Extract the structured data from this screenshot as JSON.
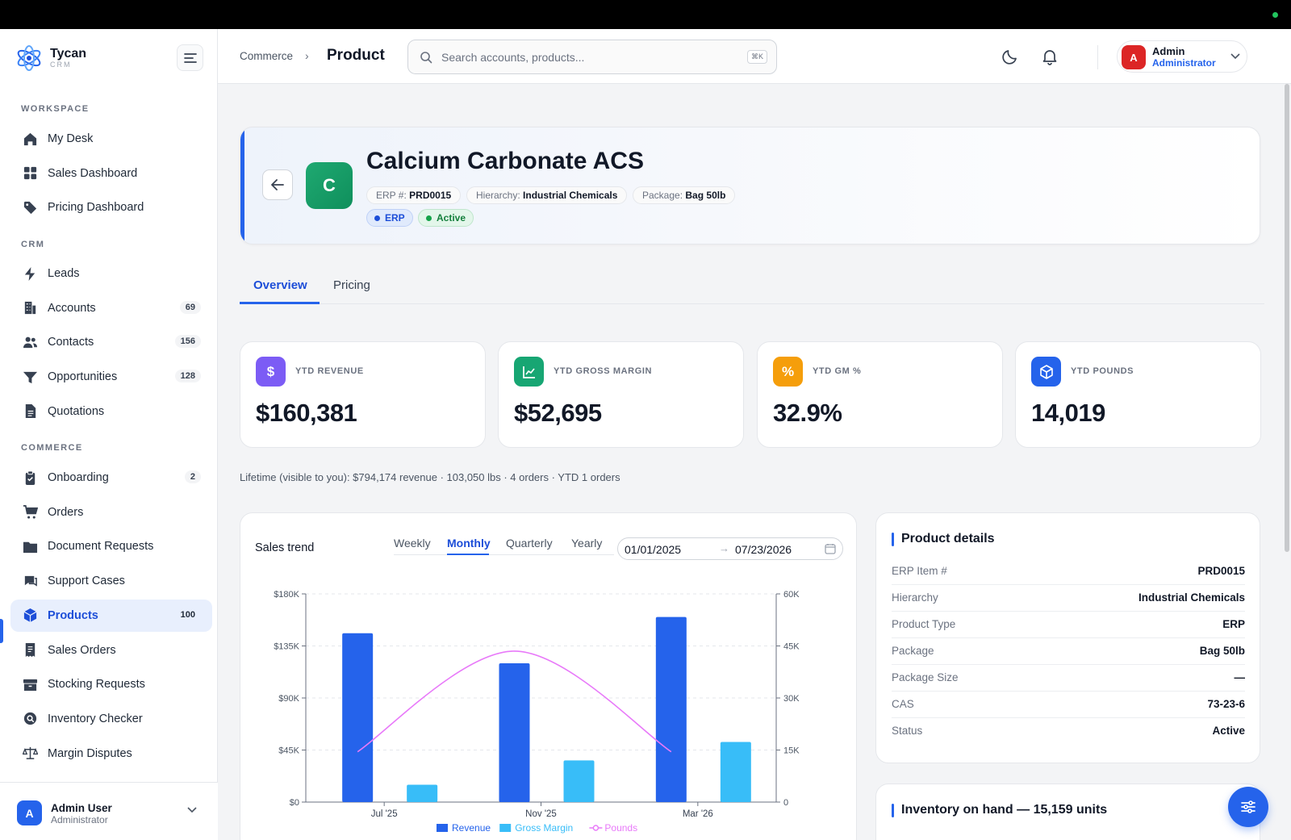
{
  "brand": {
    "name": "Tycan",
    "sub": "CRM"
  },
  "sidebar": {
    "sections": {
      "workspace": "WORKSPACE",
      "crm": "CRM",
      "commerce": "COMMERCE"
    },
    "workspace": [
      {
        "label": "My Desk",
        "icon": "home-icon"
      },
      {
        "label": "Sales Dashboard",
        "icon": "grid-icon"
      },
      {
        "label": "Pricing Dashboard",
        "icon": "tag-icon"
      }
    ],
    "crm": [
      {
        "label": "Leads",
        "icon": "bolt-icon"
      },
      {
        "label": "Accounts",
        "icon": "building-icon",
        "badge": "69"
      },
      {
        "label": "Contacts",
        "icon": "users-icon",
        "badge": "156"
      },
      {
        "label": "Opportunities",
        "icon": "funnel-icon",
        "badge": "128"
      },
      {
        "label": "Quotations",
        "icon": "document-icon"
      }
    ],
    "commerce": [
      {
        "label": "Onboarding",
        "icon": "clipboard-check-icon",
        "badge": "2"
      },
      {
        "label": "Orders",
        "icon": "cart-icon"
      },
      {
        "label": "Document Requests",
        "icon": "folder-icon"
      },
      {
        "label": "Support Cases",
        "icon": "chat-icon"
      },
      {
        "label": "Products",
        "icon": "cube-icon",
        "badge": "100",
        "active": true
      },
      {
        "label": "Sales Orders",
        "icon": "receipt-icon"
      },
      {
        "label": "Stocking Requests",
        "icon": "archive-icon"
      },
      {
        "label": "Inventory Checker",
        "icon": "magnifier-icon"
      },
      {
        "label": "Margin Disputes",
        "icon": "scale-icon"
      }
    ],
    "user": {
      "initial": "A",
      "name": "Admin User",
      "role": "Administrator"
    }
  },
  "header": {
    "breadcrumb_parent": "Commerce",
    "breadcrumb_sep": "›",
    "page_title": "Product",
    "search_placeholder": "Search accounts, products...",
    "search_shortcut": "⌘K",
    "profile": {
      "initial": "A",
      "name": "Admin",
      "role": "Administrator"
    }
  },
  "product": {
    "initial": "C",
    "name": "Calcium Carbonate ACS",
    "chips": [
      {
        "key": "ERP #:",
        "value": "PRD0015"
      },
      {
        "key": "Hierarchy:",
        "value": "Industrial Chemicals"
      },
      {
        "key": "Package:",
        "value": "Bag 50lb"
      }
    ],
    "tags": [
      "ERP",
      "Active"
    ]
  },
  "tabs": [
    "Overview",
    "Pricing"
  ],
  "kpis": [
    {
      "label": "YTD REVENUE",
      "value": "$160,381",
      "icon": "dollar-icon",
      "color": "#7c5cf5",
      "glyph": "$"
    },
    {
      "label": "YTD GROSS MARGIN",
      "value": "$52,695",
      "icon": "line-chart-icon",
      "color": "#17a673",
      "glyph": ""
    },
    {
      "label": "YTD GM %",
      "value": "32.9%",
      "icon": "percent-icon",
      "color": "#f59e0b",
      "glyph": "%"
    },
    {
      "label": "YTD POUNDS",
      "value": "14,019",
      "icon": "box-icon",
      "color": "#2563eb",
      "glyph": ""
    }
  ],
  "lifetime": "Lifetime (visible to you): $794,174 revenue · 103,050 lbs · 4 orders · YTD 1 orders",
  "sales_trend": {
    "title": "Sales trend",
    "ranges": [
      "Weekly",
      "Monthly",
      "Quarterly",
      "Yearly"
    ],
    "active_range": "Monthly",
    "date_from": "01/01/2025",
    "date_arrow": "→",
    "date_to": "07/23/2026"
  },
  "chart_data": {
    "type": "bar",
    "categories": [
      "Jul '25",
      "Nov '25",
      "Mar '26"
    ],
    "series": [
      {
        "name": "Revenue",
        "type": "bar",
        "axis": "left",
        "color": "#2563eb",
        "values": [
          146000,
          120000,
          160000
        ]
      },
      {
        "name": "Gross Margin",
        "type": "bar",
        "axis": "left",
        "color": "#38bdf8",
        "values": [
          15000,
          36000,
          52000
        ]
      },
      {
        "name": "Pounds",
        "type": "line",
        "axis": "right",
        "color": "#e879f9",
        "values": [
          14500,
          43500,
          14500
        ]
      }
    ],
    "y_left": {
      "ticks": [
        "$0",
        "$45K",
        "$90K",
        "$135K",
        "$180K"
      ],
      "min": 0,
      "max": 180000
    },
    "y_right": {
      "ticks": [
        "0",
        "15K",
        "30K",
        "45K",
        "60K"
      ],
      "min": 0,
      "max": 60000
    },
    "grid": true,
    "legend": "bottom"
  },
  "product_details": {
    "title": "Product details",
    "rows": [
      {
        "key": "ERP Item #",
        "value": "PRD0015"
      },
      {
        "key": "Hierarchy",
        "value": "Industrial Chemicals"
      },
      {
        "key": "Product Type",
        "value": "ERP"
      },
      {
        "key": "Package",
        "value": "Bag 50lb"
      },
      {
        "key": "Package Size",
        "value": "—"
      },
      {
        "key": "CAS",
        "value": "73-23-6"
      },
      {
        "key": "Status",
        "value": "Active"
      }
    ]
  },
  "inventory": {
    "title": "Inventory on hand — 15,159 units"
  }
}
